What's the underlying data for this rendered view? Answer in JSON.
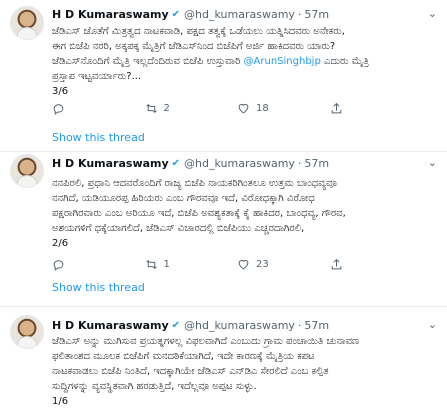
{
  "tweets": [
    {
      "name": "H D Kumaraswamy",
      "handle": "@hd_kumaraswamy",
      "sep": "·",
      "time": "57m",
      "lines": [
        "ಜೆಡಿಎಸ್ ಜೊತೆಗೆ ಮಿತ್ರತ್ವದ ನಾಟಕವಾಡಿ, ಪಕ್ಷದ ತತ್ವಕ್ಕೆ ಒಡೆಯಲು ಯತ್ನಿಸಿದವರು ಅನೇಕರು,",
        "ಈಗ ಬಿಜೆಪಿ ನರರಿ, ಅಕ್ಕಪಕ್ಕ ಮೈತ್ರಿಗೆ ಜೆಡಿಎಸ್‌ನಿಂದ ಬಿಜೆಪಿಗೆ ಅರ್ಜಿ ಹಾಕಿದವರು ಯಾರು?",
        "ಜೆಡಿಎಸ್‌ನೊಂದಿಗೆ ಮೈತ್ರಿ ಇಲ್ಲದೆಂದಿರುವ ಬಿಜೆಪಿ ಉಸ್ತುವಾರಿ",
        "ಪ್ರಸ್ತಾಪ ಇಟ್ಟವರ್ಯಾರು?...",
        "3/6"
      ],
      "mention": "@ArunSinghbjp",
      "mention_tail": " ಎದುರು ಮೈತ್ರಿ",
      "replies": "",
      "retweets": "2",
      "likes": "18",
      "show_thread": "Show this thread"
    },
    {
      "name": "H D Kumaraswamy",
      "handle": "@hd_kumaraswamy",
      "sep": "·",
      "time": "57m",
      "lines": [
        "ನನಪಿರಲಿ, ಪ್ರಧಾನಿ ಆದವರೊಂದಿಗೆ ರಾಜ್ಯ ಬಿಜೆಪಿ ನಾಯಕರಿಗಿಂತಲೂ ಉತ್ತಮ ಬಾಂಧವ್ಯವೂ",
        "ನನಗಿದೆ, ಯಡಿಯೂರಪ್ಪ ಹಿರಿಯರು ಎಂಬ ಗೌರವವೂ ಇದೆ, ವಿರೋಧಕ್ಕಾಗಿ ವಿರೋಧ",
        "ಪಕ್ಷರಾಗಿರವಾರು ಎಂಬ ಅರಿಯೂ ಇದೆ, ಬಿಜೆಪಿ ಅವಶ್ಯಕತಾಕ್ಕೆ ಕೈ ಹಾಕಿದರ, ಬಾಂಧವ್ಯ, ಗೌರವ,",
        "ಅಶಯಗಳಿಗೆ ಧಕ್ಕೆಯಾಗಲಿದೆ, ಜೆಡಿಎಸ್ ವಿಚಾರದಲ್ಲಿ ಬಿಜೆಪಿಯು ಎಚ್ಚರದಾಗಿರಲಿ,",
        "2/6"
      ],
      "mention": "",
      "mention_tail": "",
      "replies": "",
      "retweets": "1",
      "likes": "23",
      "show_thread": "Show this thread"
    },
    {
      "name": "H D Kumaraswamy",
      "handle": "@hd_kumaraswamy",
      "sep": "·",
      "time": "57m",
      "lines": [
        "ಜೆಡಿಎಸ್ ಅನ್ನು ಮುಗಿಸುವ ಪ್ರಯತ್ನಗಳಲ್ಲ ವಿಫಲವಾಗಿದೆ ಎಂಬುದು ಗ್ರಾಮ ಪಂಚಾಯಿತಿ ಚುನಾವಣ",
        "ಫಲಿತಾಂಶದ ಮೂಲಕ ಬಿಜೆಪಿಗೆ ಮನದಠಿಕೆಯಾಗಿದೆ, ಇದೇ ಕಾರಣಕ್ಕೆ ಮೈತ್ರಿಯ ಕಪಟ",
        "ನಾಟಕವಾಡಲು ಬಿಜೆಪಿ ನಿಂತಿದೆ, ಇದಕ್ಕಾಗಿಯೇ ಜೆಡಿಎಸ್ ಎನ್‌ಡಿಎ ಸೇರಲಿದೆ ಎಂಬ ಕಲ್ಪಿತ",
        "ಸುದ್ದಿಗಳನ್ನು ವ್ಯವಸ್ಥಿತವಾಗಿ ಹರಡುತ್ತಿದೆ, ಇದೆಲ್ಲವೂ ಅಪ್ಪಟ ಸುಳ್ಳು.",
        "1/6"
      ],
      "mention": "",
      "mention_tail": "",
      "replies": "",
      "retweets": "",
      "likes": "",
      "show_thread": ""
    }
  ]
}
